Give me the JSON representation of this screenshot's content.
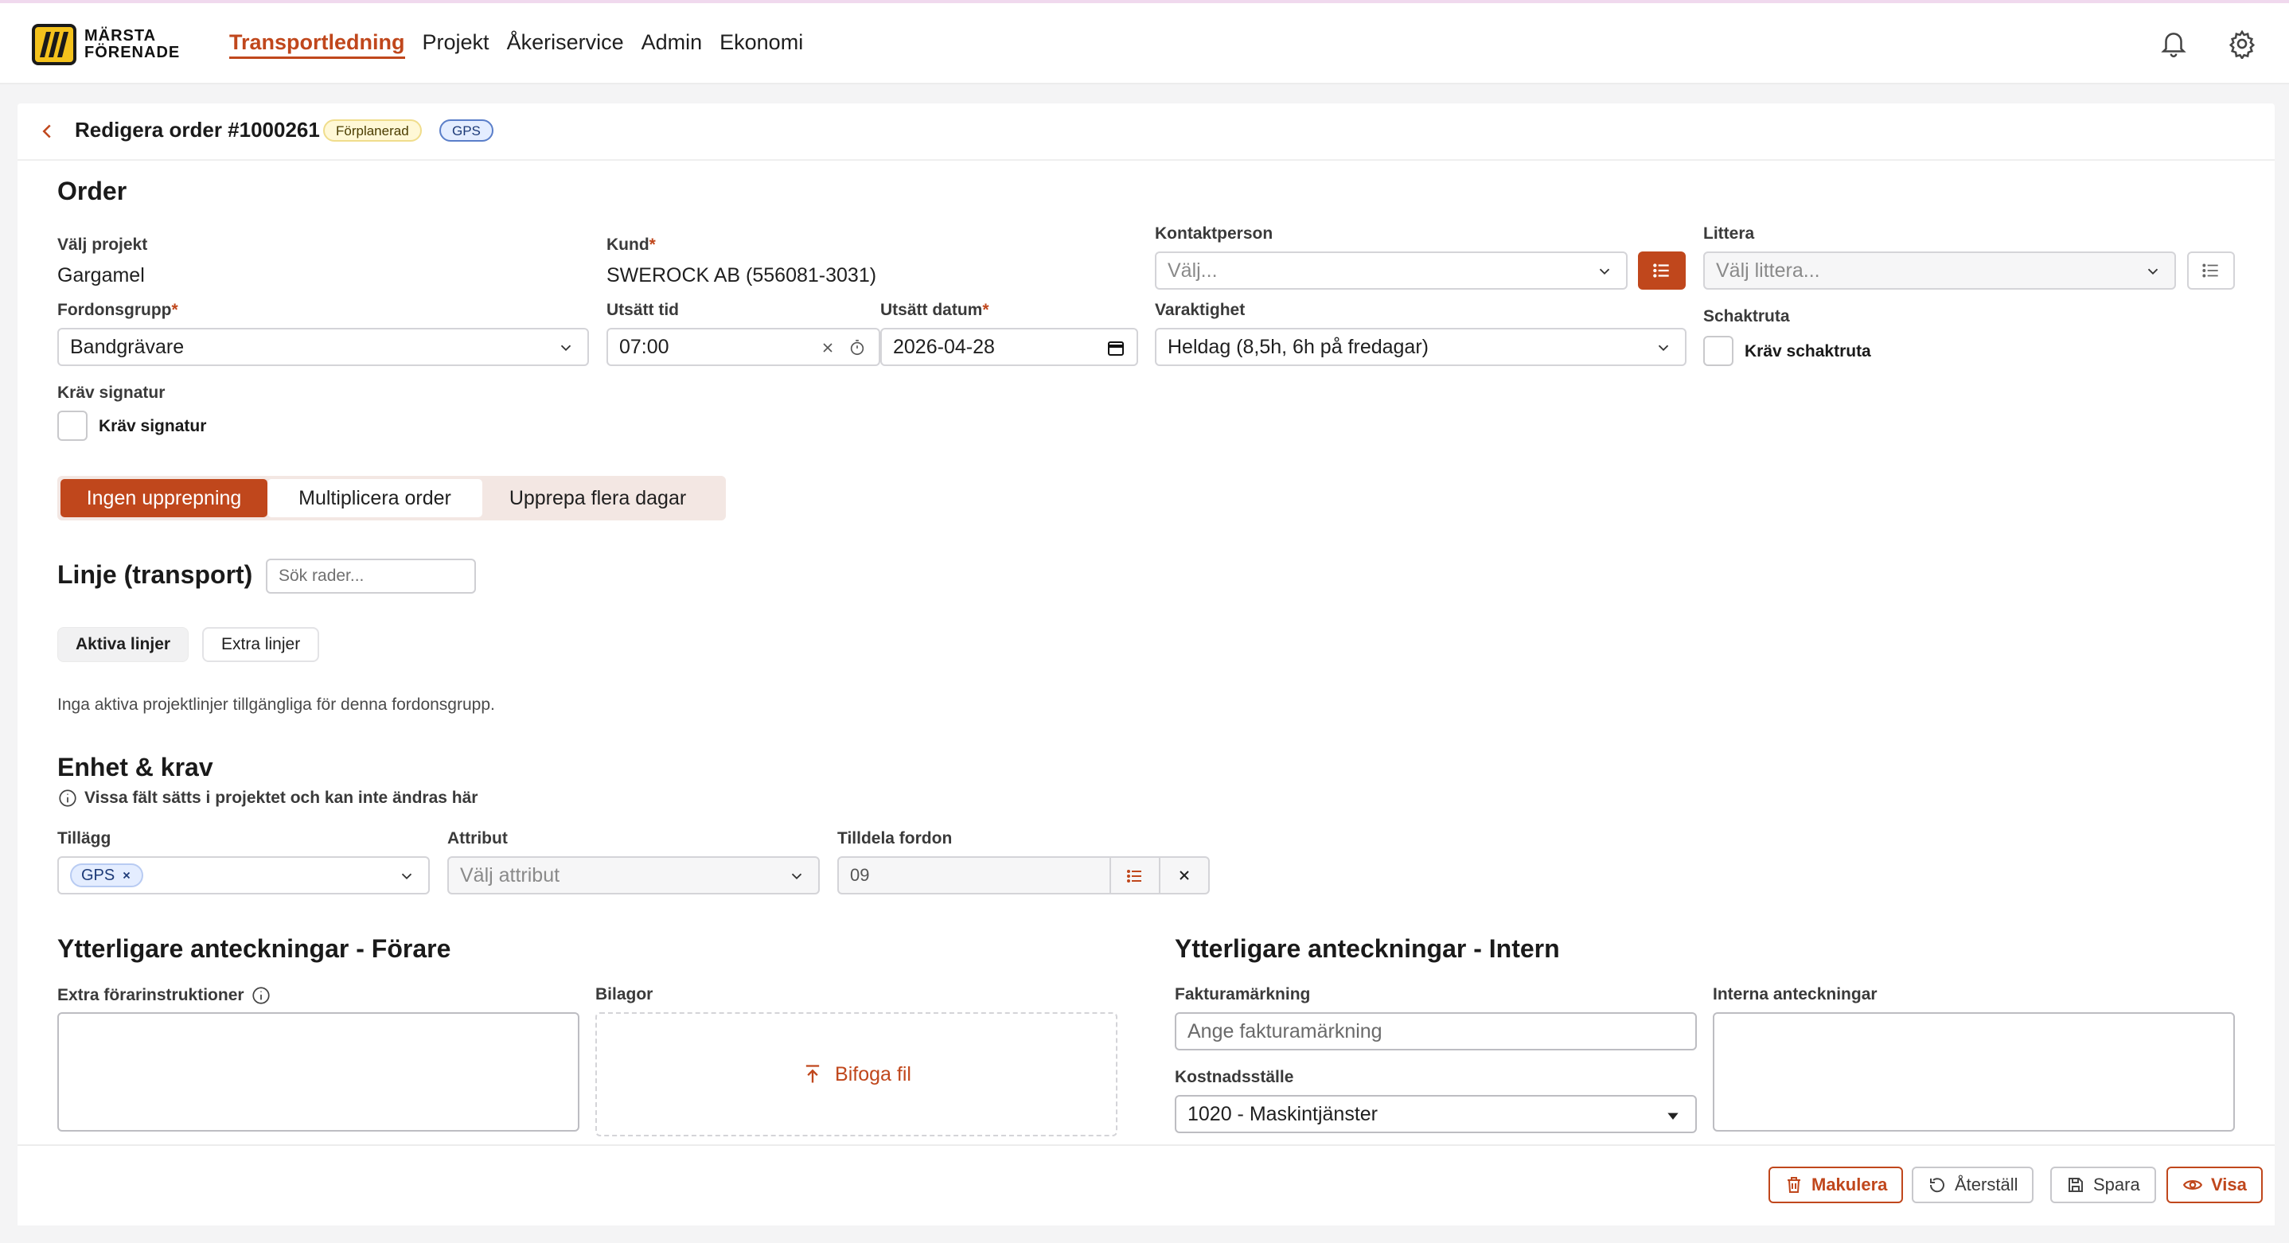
{
  "brand": {
    "line1": "MÄRSTA",
    "line2": "FÖRENADE"
  },
  "nav": [
    "Transportledning",
    "Projekt",
    "Åkeriservice",
    "Admin",
    "Ekonomi"
  ],
  "page": {
    "title": "Redigera order #1000261",
    "status_badge": "Förplanerad",
    "gps_badge": "GPS"
  },
  "order": {
    "heading": "Order",
    "project_label": "Välj projekt",
    "project_value": "Gargamel",
    "customer_label": "Kund",
    "customer_value": "SWEROCK AB (556081-3031)",
    "contact_label": "Kontaktperson",
    "contact_placeholder": "Välj...",
    "littera_label": "Littera",
    "littera_placeholder": "Välj littera...",
    "vehicle_group_label": "Fordonsgrupp",
    "vehicle_group_value": "Bandgrävare",
    "time_label": "Utsätt tid",
    "time_value": "07:00",
    "date_label": "Utsätt datum",
    "date_value": "2026-04-28",
    "duration_label": "Varaktighet",
    "duration_value": "Heldag (8,5h, 6h på fredagar)",
    "shaft_label": "Schaktruta",
    "shaft_check": "Kräv schaktruta",
    "signature_label": "Kräv signatur",
    "signature_check": "Kräv signatur",
    "required_mark": "*"
  },
  "repeat": [
    "Ingen upprepning",
    "Multiplicera order",
    "Upprepa flera dagar"
  ],
  "lines": {
    "heading": "Linje (transport)",
    "search_placeholder": "Sök rader...",
    "tabs": [
      "Aktiva linjer",
      "Extra linjer"
    ],
    "empty": "Inga aktiva projektlinjer tillgängliga för denna fordonsgrupp."
  },
  "unit": {
    "heading": "Enhet & krav",
    "info": "Vissa fält sätts i projektet och kan inte ändras här",
    "addons_label": "Tillägg",
    "addons_chip": "GPS",
    "attr_label": "Attribut",
    "attr_placeholder": "Välj attribut",
    "assign_label": "Tilldela fordon",
    "assign_value": "09"
  },
  "notes_driver": {
    "heading": "Ytterligare anteckningar - Förare",
    "extra_label": "Extra förarinstruktioner",
    "attach_label": "Bilagor",
    "attach_button": "Bifoga fil"
  },
  "notes_internal": {
    "heading": "Ytterligare anteckningar - Intern",
    "invoice_label": "Fakturamärkning",
    "invoice_placeholder": "Ange fakturamärkning",
    "cost_label": "Kostnadsställe",
    "cost_value": "1020 - Maskintjänster",
    "internal_label": "Interna anteckningar"
  },
  "footer": [
    "Makulera",
    "Återställ",
    "Spara",
    "Visa"
  ],
  "colors": {
    "accent": "#c0471c",
    "brand_yellow": "#f4c21c"
  }
}
